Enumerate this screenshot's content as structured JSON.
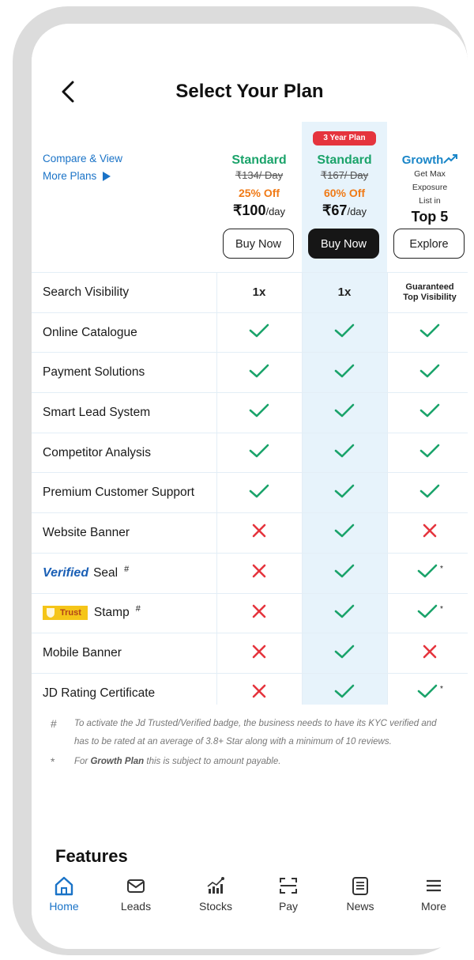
{
  "header": {
    "title": "Select Your Plan"
  },
  "compare": {
    "line1": "Compare & View",
    "line2": "More Plans"
  },
  "plans": [
    {
      "name": "Standard",
      "was": "₹134/ Day",
      "off": "25% Off",
      "price": "₹100",
      "unit": "/day",
      "button": "Buy Now"
    },
    {
      "badge": "3 Year Plan",
      "name": "Standard",
      "was": "₹167/ Day",
      "off": "60% Off",
      "price": "₹67",
      "unit": "/day",
      "button": "Buy Now"
    },
    {
      "name": "Growth",
      "line1": "Get Max",
      "line2": "Exposure",
      "line3": "List in",
      "top": "Top 5",
      "button": "Explore"
    }
  ],
  "rows": [
    {
      "label": "Search Visibility",
      "v1": "1x",
      "v2": "1x",
      "v3a": "Guaranteed",
      "v3b": "Top Visibility"
    },
    {
      "label": "Online Catalogue"
    },
    {
      "label": "Payment Solutions"
    },
    {
      "label": "Smart Lead System"
    },
    {
      "label": "Competitor Analysis"
    },
    {
      "label": "Premium Customer Support"
    },
    {
      "label": "Website Banner"
    },
    {
      "label": "Seal",
      "prefix": "Verified",
      "sup": "#"
    },
    {
      "label": "Stamp",
      "prefix": "Trust",
      "sup": "#"
    },
    {
      "label": "Mobile Banner"
    },
    {
      "label": "JD Rating Certificate"
    }
  ],
  "asterisk": "*",
  "notes": [
    {
      "sym": "#",
      "text": "To activate the Jd Trusted/Verified badge, the business needs to have its KYC verified and has to be rated at an average of 3.8+ Star along with a minimum of 10 reviews."
    },
    {
      "sym": "*",
      "pre": "For ",
      "bold": "Growth Plan",
      "post": " this is subject to amount payable."
    }
  ],
  "features_title": "Features",
  "nav": [
    {
      "label": "Home",
      "icon": "home-icon",
      "active": true
    },
    {
      "label": "Leads",
      "icon": "mail-icon"
    },
    {
      "label": "Stocks",
      "icon": "stocks-icon"
    },
    {
      "label": "Pay",
      "icon": "scan-icon"
    },
    {
      "label": "News",
      "icon": "news-icon"
    },
    {
      "label": "More",
      "icon": "menu-icon"
    }
  ],
  "colors": {
    "accent": "#1a73c7",
    "green": "#1aa36a",
    "orange": "#f07a16",
    "red": "#e5343d",
    "highlight": "#e7f3fb"
  }
}
